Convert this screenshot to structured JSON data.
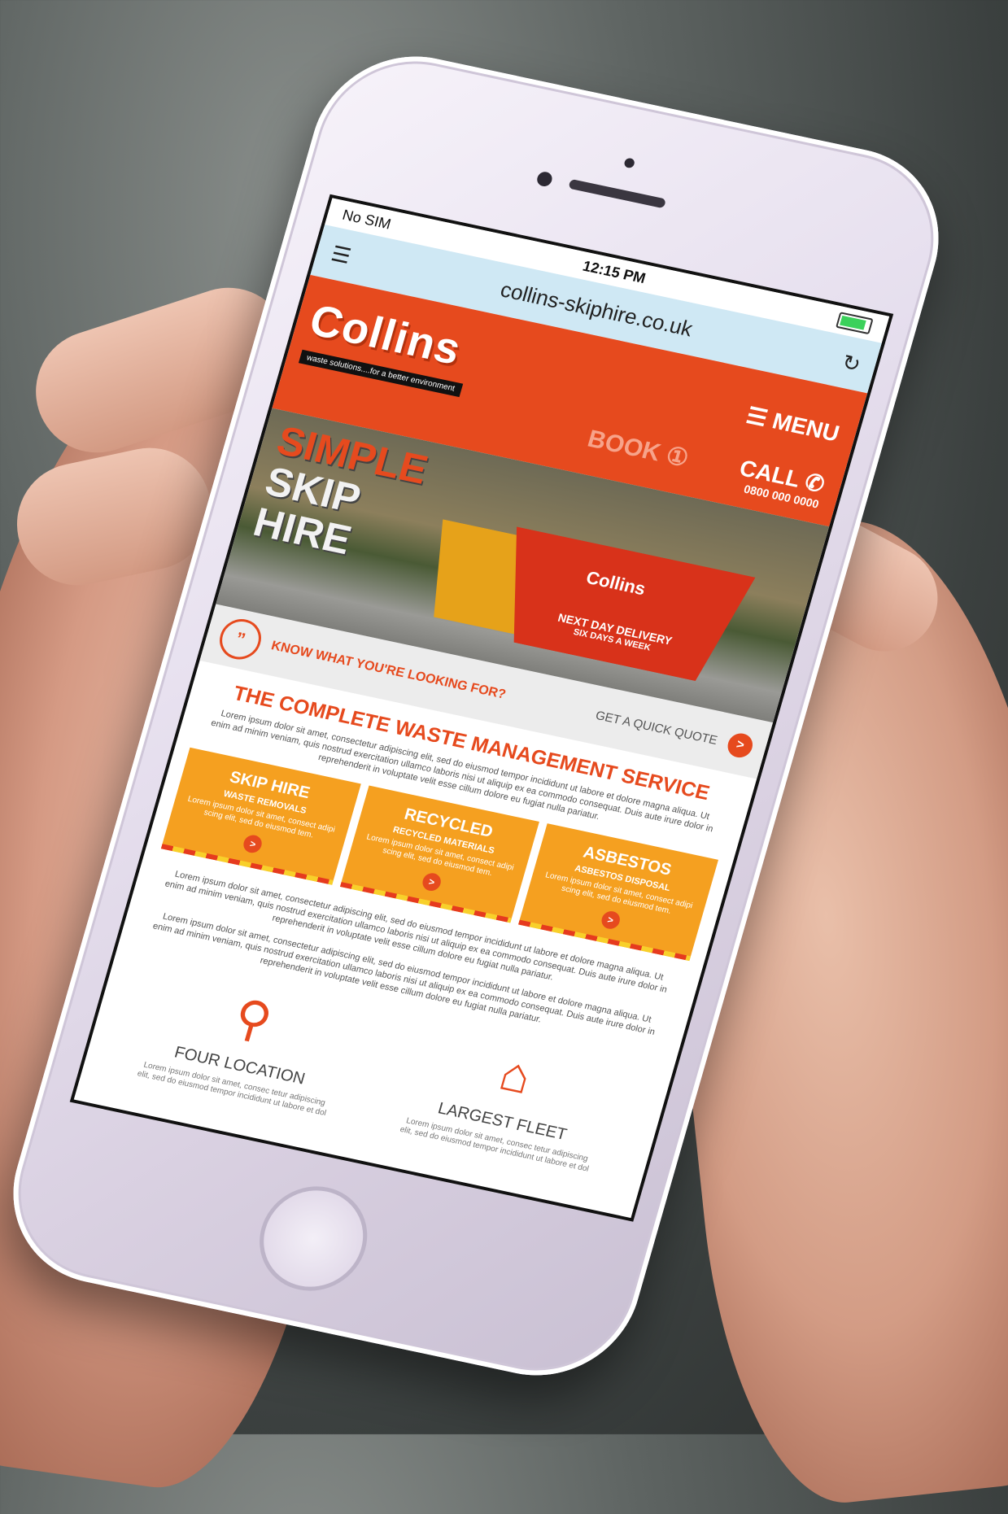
{
  "statusbar": {
    "carrier": "No SIM",
    "time": "12:15 PM"
  },
  "browser": {
    "url": "collins-skiphire.co.uk"
  },
  "header": {
    "logo": "Collins",
    "tagline": "waste solutions....for a better environment",
    "menu_label": "MENU",
    "book_label": "BOOK",
    "call_label": "CALL",
    "phone": "0800 000 0000"
  },
  "hero": {
    "title_line1": "SIMPLE",
    "title_line2": "SKIP",
    "title_line3": "HIRE",
    "skip_brand": "Collins",
    "delivery_line1": "NEXT DAY DELIVERY",
    "delivery_line2": "SIX DAYS A WEEK"
  },
  "quote": {
    "text": "KNOW WHAT YOU'RE LOOKING FOR?",
    "cta": "GET A QUICK QUOTE"
  },
  "main": {
    "title": "THE COMPLETE WASTE MANAGEMENT SERVICE",
    "intro": "Lorem ipsum dolor sit amet, consectetur adipiscing elit, sed do eiusmod tempor incididunt ut labore et dolore magna aliqua. Ut enim ad minim veniam, quis nostrud exercitation ullamco laboris nisi ut aliquip ex ea commodo consequat. Duis aute irure dolor in reprehenderit in voluptate velit esse cillum dolore eu fugiat nulla pariatur.",
    "cards": [
      {
        "title": "SKIP HIRE",
        "subtitle": "WASTE REMOVALS",
        "body": "Lorem ipsum dolor sit amet, consect adipi scing elit, sed do eiusmod tem."
      },
      {
        "title": "RECYCLED",
        "subtitle": "RECYCLED MATERIALS",
        "body": "Lorem ipsum dolor sit amet, consect adipi scing elit, sed do eiusmod tem."
      },
      {
        "title": "ASBESTOS",
        "subtitle": "ASBESTOS DISPOSAL",
        "body": "Lorem ipsum dolor sit amet, consect adipi scing elit, sed do eiusmod tem."
      }
    ],
    "para1": "Lorem ipsum dolor sit amet, consectetur adipiscing elit, sed do eiusmod tempor incididunt ut labore et dolore magna aliqua. Ut enim ad minim veniam, quis nostrud exercitation ullamco laboris nisi ut aliquip ex ea commodo consequat. Duis aute irure dolor in reprehenderit in voluptate velit esse cillum dolore eu fugiat nulla pariatur.",
    "para2": "Lorem ipsum dolor sit amet, consectetur adipiscing elit, sed do eiusmod tempor incididunt ut labore et dolore magna aliqua. Ut enim ad minim veniam, quis nostrud exercitation ullamco laboris nisi ut aliquip ex ea commodo consequat. Duis aute irure dolor in reprehenderit in voluptate velit esse cillum dolore eu fugiat nulla pariatur."
  },
  "features": [
    {
      "icon": "location-pin-icon",
      "title": "FOUR LOCATION",
      "body": "Lorem ipsum dolor sit amet, consec tetur adipiscing elit, sed do eiusmod tempor incididunt ut labore et dol"
    },
    {
      "icon": "garage-icon",
      "title": "LARGEST FLEET",
      "body": "Lorem ipsum dolor sit amet, consec tetur adipiscing elit, sed do eiusmod tempor incididunt ut labore et dol"
    }
  ],
  "colors": {
    "brand": "#e64a1e",
    "card": "#f5a020",
    "urlbar": "#cfe8f4"
  }
}
